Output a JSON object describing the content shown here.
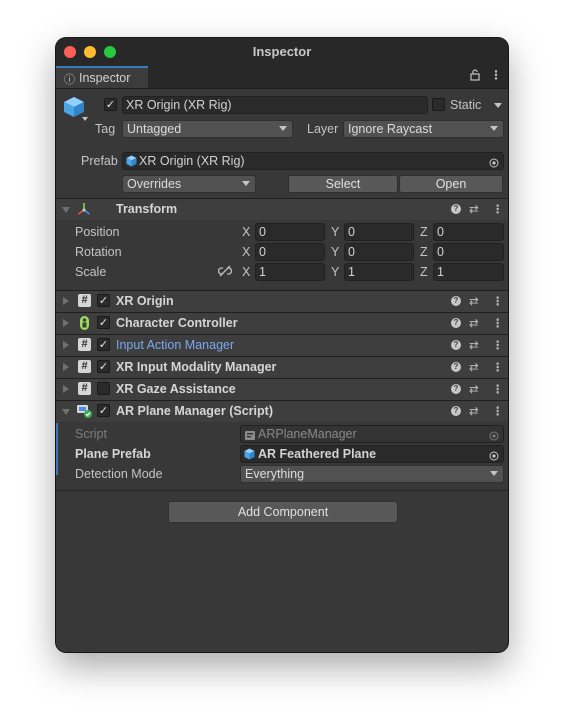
{
  "window": {
    "title": "Inspector"
  },
  "tab": {
    "label": "Inspector",
    "icon": "info-icon"
  },
  "object": {
    "name": "XR Origin (XR Rig)",
    "active": true,
    "static_label": "Static",
    "static": false,
    "tag_label": "Tag",
    "tag": "Untagged",
    "layer_label": "Layer",
    "layer": "Ignore Raycast"
  },
  "prefab": {
    "label": "Prefab",
    "value": "XR Origin (XR Rig)",
    "overrides": "Overrides",
    "select": "Select",
    "open": "Open"
  },
  "transform": {
    "title": "Transform",
    "position_label": "Position",
    "rotation_label": "Rotation",
    "scale_label": "Scale",
    "x": "X",
    "y": "Y",
    "z": "Z",
    "position": [
      "0",
      "0",
      "0"
    ],
    "rotation": [
      "0",
      "0",
      "0"
    ],
    "scale": [
      "1",
      "1",
      "1"
    ]
  },
  "components": [
    {
      "name": "XR Origin",
      "enabled": true,
      "icon": "script-icon"
    },
    {
      "name": "Character Controller",
      "enabled": true,
      "icon": "character-controller-icon"
    },
    {
      "name": "Input Action Manager",
      "enabled": true,
      "icon": "script-icon"
    },
    {
      "name": "XR Input Modality Manager",
      "enabled": true,
      "icon": "script-icon"
    },
    {
      "name": "XR Gaze Assistance",
      "enabled": false,
      "icon": "script-icon"
    },
    {
      "name": "AR Plane Manager (Script)",
      "enabled": true,
      "icon": "ar-plane-manager-icon"
    }
  ],
  "ar_plane_manager": {
    "script_label": "Script",
    "script_value": "ARPlaneManager",
    "plane_prefab_label": "Plane Prefab",
    "plane_prefab_value": "AR Feathered Plane",
    "detection_mode_label": "Detection Mode",
    "detection_mode_value": "Everything"
  },
  "add_component": "Add Component",
  "colors": {
    "background": "#383838",
    "titlebar": "#282828",
    "accent_blue": "#3a79bb",
    "highlight_text": "#7aa8f0"
  }
}
